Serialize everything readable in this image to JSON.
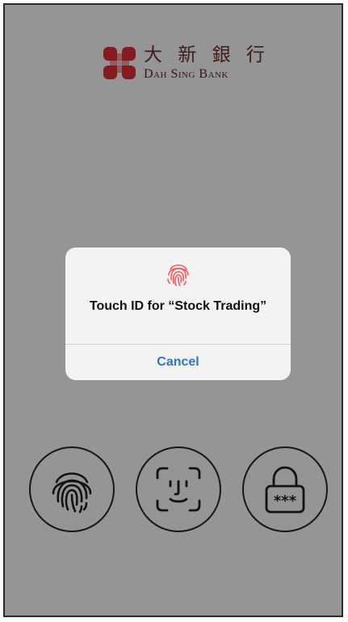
{
  "brand": {
    "name_cn": "大 新 銀 行",
    "name_en": "Dah Sing Bank",
    "mark_color": "#c1272d"
  },
  "auth_buttons": [
    {
      "name": "fingerprint-login",
      "icon": "fingerprint-icon"
    },
    {
      "name": "face-id-login",
      "icon": "face-id-icon"
    },
    {
      "name": "password-login",
      "icon": "lock-password-icon",
      "lock_text": "***"
    }
  ],
  "dialog": {
    "icon": "touch-id-fingerprint-icon",
    "icon_color": "#f05a5a",
    "title": "Touch ID for “Stock Trading”",
    "cancel_label": "Cancel",
    "cancel_color": "#2c74d4"
  }
}
